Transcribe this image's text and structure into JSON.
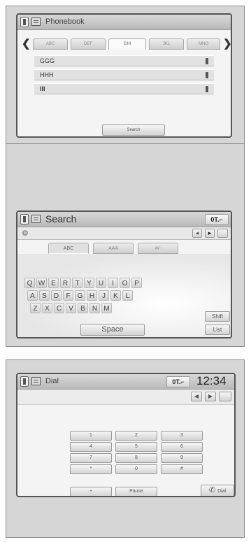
{
  "phonebook": {
    "title": "Phonebook",
    "tabs": [
      "ABC",
      "DEF",
      "GHI",
      "JKL",
      "MNO"
    ],
    "arrow_left": "❮",
    "arrow_right": "❯",
    "contacts": [
      "GGG",
      "HHH",
      "III"
    ],
    "search_button": "Search"
  },
  "transition_arrow": "↓",
  "search": {
    "title": "Search",
    "signal": "0T.⌐",
    "tabs": [
      "ABC",
      "AAA",
      "#/-"
    ],
    "keyboard_rows": [
      [
        "Q",
        "W",
        "E",
        "R",
        "T",
        "Y",
        "U",
        "I",
        "O",
        "P"
      ],
      [
        "A",
        "S",
        "D",
        "F",
        "G",
        "H",
        "J",
        "K",
        "L"
      ],
      [
        "Z",
        "X",
        "C",
        "V",
        "B",
        "N",
        "M"
      ]
    ],
    "space_label": "Space",
    "shift_label": "Shift",
    "list_label": "List",
    "back_arrow": "◂",
    "forward_arrow": "▸",
    "settings_icon": "⚙"
  },
  "dial": {
    "title": "Dial",
    "signal": "0T.⌐",
    "time": "12:34",
    "left_arrow": "◀",
    "right_arrow": "▶",
    "keypad": [
      [
        "1",
        "2",
        "3"
      ],
      [
        "4",
        "5",
        "6"
      ],
      [
        "7",
        "8",
        "9"
      ],
      [
        "*",
        "0",
        "#"
      ]
    ],
    "plus_label": "+",
    "pause_label": "Pause",
    "dial_label": "Dial",
    "handset_icon": "✆"
  }
}
